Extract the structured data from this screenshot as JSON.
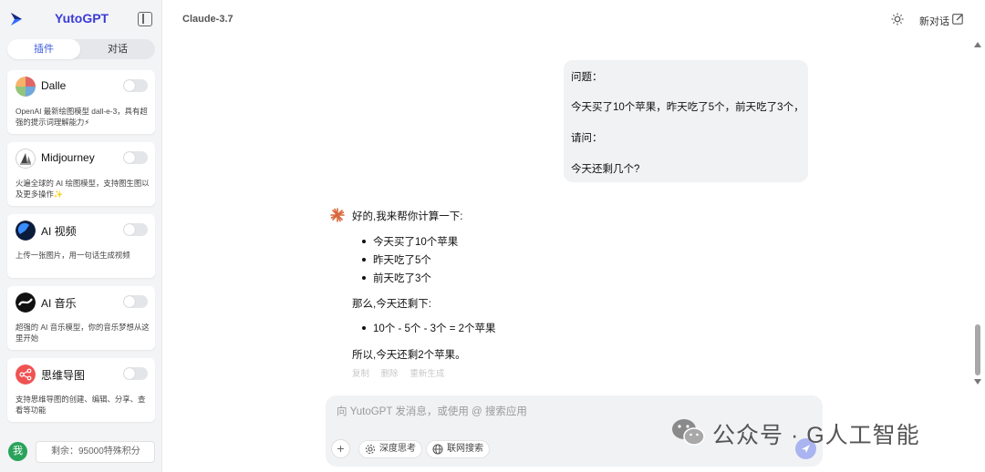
{
  "app": {
    "name": "YutoGPT",
    "model": "Claude-3.7",
    "new_chat_label": "新对话"
  },
  "sidebar": {
    "tabs": [
      {
        "label": "插件",
        "active": true
      },
      {
        "label": "对话",
        "active": false
      }
    ],
    "plugins": [
      {
        "name": "Dalle",
        "desc": "OpenAI 最新绘图模型 dall-e-3，具有超强的提示词理解能力⚡",
        "enabled": false
      },
      {
        "name": "Midjourney",
        "desc": "火遍全球的 AI 绘图模型，支持图生图以及更多操作✨",
        "enabled": false
      },
      {
        "name": "AI 视频",
        "desc": "上传一张图片，用一句话生成视频",
        "enabled": false
      },
      {
        "name": "AI 音乐",
        "desc": "超强的 AI 音乐模型，你的音乐梦想从这里开始",
        "enabled": false
      },
      {
        "name": "思维导图",
        "desc": "支持思维导图的创建、编辑、分享、查看等功能",
        "enabled": false
      }
    ],
    "user_avatar": "我",
    "credits_text": "剩余：95000特殊积分"
  },
  "chat": {
    "user_message": {
      "lines": [
        "问题：",
        "今天买了10个苹果，昨天吃了5个，前天吃了3个，",
        "请问：",
        "今天还剩几个?"
      ]
    },
    "ai_message": {
      "intro": "好的,我来帮你计算一下:",
      "list1": [
        "今天买了10个苹果",
        "昨天吃了5个",
        "前天吃了3个"
      ],
      "mid": "那么,今天还剩下:",
      "list2": [
        "10个 - 5个 - 3个 = 2个苹果"
      ],
      "conclusion": "所以,今天还剩2个苹果。",
      "actions": [
        "复制",
        "删除",
        "重新生成"
      ]
    }
  },
  "composer": {
    "placeholder": "向 YutoGPT 发消息，或使用 @ 搜索应用",
    "deep_think_label": "深度思考",
    "web_search_label": "联网搜索"
  },
  "watermark": {
    "text": "公众号 · G人工智能"
  },
  "colors": {
    "brand": "#3b3bd6",
    "active_tab_text": "#3b5bdb",
    "send_button": "#aab4f0",
    "user_avatar_bg": "#2aa35a"
  }
}
